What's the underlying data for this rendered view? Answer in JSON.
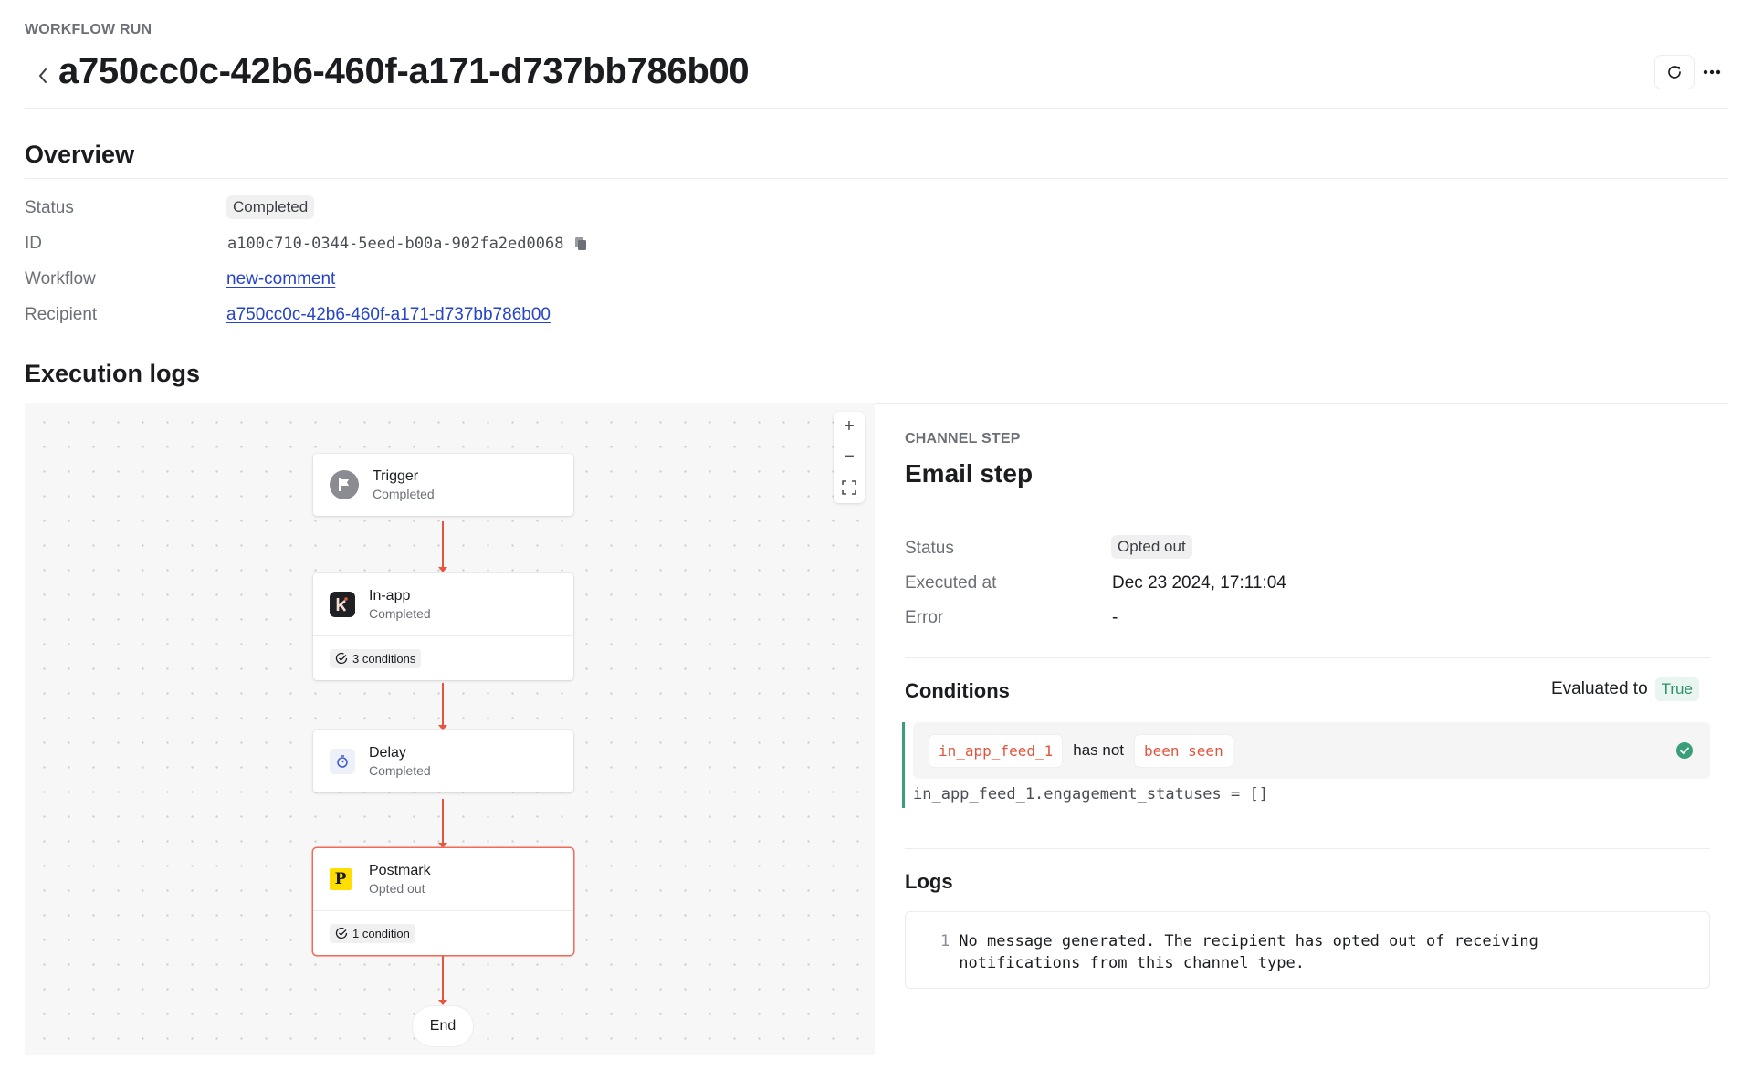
{
  "header": {
    "eyebrow": "WORKFLOW RUN",
    "title": "a750cc0c-42b6-460f-a171-d737bb786b00",
    "back_icon": "chevron-left-icon",
    "refresh_icon": "refresh-icon",
    "more_icon": "more-horizontal-icon"
  },
  "overview": {
    "title": "Overview",
    "rows": [
      {
        "label": "Status",
        "value": "Completed",
        "kind": "badge"
      },
      {
        "label": "ID",
        "value": "a100c710-0344-5eed-b00a-902fa2ed0068",
        "kind": "mono-copy"
      },
      {
        "label": "Workflow",
        "value": "new-comment",
        "kind": "link"
      },
      {
        "label": "Recipient",
        "value": "a750cc0c-42b6-460f-a171-d737bb786b00",
        "kind": "link"
      }
    ]
  },
  "execution": {
    "title": "Execution logs",
    "nodes": [
      {
        "title": "Trigger",
        "status": "Completed",
        "icon": "flag-icon"
      },
      {
        "title": "In-app",
        "status": "Completed",
        "icon": "knock-logo-icon",
        "conditions": "3 conditions"
      },
      {
        "title": "Delay",
        "status": "Completed",
        "icon": "timer-icon"
      },
      {
        "title": "Postmark",
        "status": "Opted out",
        "icon": "postmark-logo-icon",
        "conditions": "1 condition",
        "selected": true
      }
    ],
    "end_label": "End",
    "zoom_controls": {
      "zoom_in": "+",
      "zoom_out": "−",
      "fit": "fit-view-icon"
    },
    "accent_color": "#e8553e"
  },
  "step": {
    "eyebrow": "CHANNEL STEP",
    "title": "Email step",
    "details": [
      {
        "label": "Status",
        "value": "Opted out"
      },
      {
        "label": "Executed at",
        "value": "Dec 23 2024, 17:11:04"
      },
      {
        "label": "Error",
        "value": "-"
      }
    ],
    "conditions": {
      "title": "Conditions",
      "evaluated_label": "Evaluated to",
      "evaluated_value": "True",
      "items": [
        {
          "variable": "in_app_feed_1",
          "operator": "has not",
          "argument": "been seen",
          "expression": "in_app_feed_1.engagement_statuses = []",
          "passed": true
        }
      ]
    },
    "logs": {
      "title": "Logs",
      "lines": [
        {
          "number": "1",
          "text": "No message generated. The recipient has opted out of receiving notifications from this channel type."
        }
      ]
    }
  }
}
